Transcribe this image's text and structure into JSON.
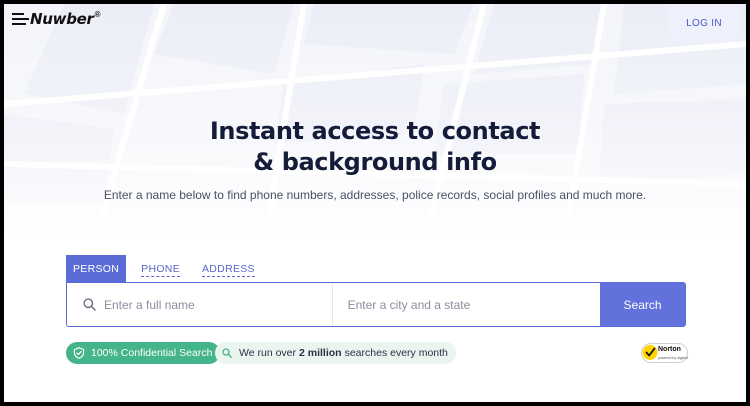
{
  "header": {
    "logo_text": "Nuwber",
    "logo_reg": "®",
    "login_label": "LOG IN"
  },
  "hero": {
    "title_line1": "Instant access to contact",
    "title_line2": "& background info",
    "subtitle": "Enter a name below to find phone numbers, addresses, police records, social profiles and much more."
  },
  "tabs": [
    {
      "label": "PERSON",
      "active": true
    },
    {
      "label": "PHONE",
      "active": false
    },
    {
      "label": "ADDRESS",
      "active": false
    }
  ],
  "search": {
    "name_placeholder": "Enter a full name",
    "city_placeholder": "Enter a city and a state",
    "button_label": "Search"
  },
  "badges": {
    "confidential": "100% Confidential Search",
    "runs_pre": "We run over",
    "runs_bold": "2 million",
    "runs_post": "searches every month"
  },
  "norton": {
    "label": "Norton",
    "sub": "powered by digicert"
  },
  "colors": {
    "accent": "#5b6cd9",
    "success": "#44b48a",
    "title": "#141c3a"
  }
}
